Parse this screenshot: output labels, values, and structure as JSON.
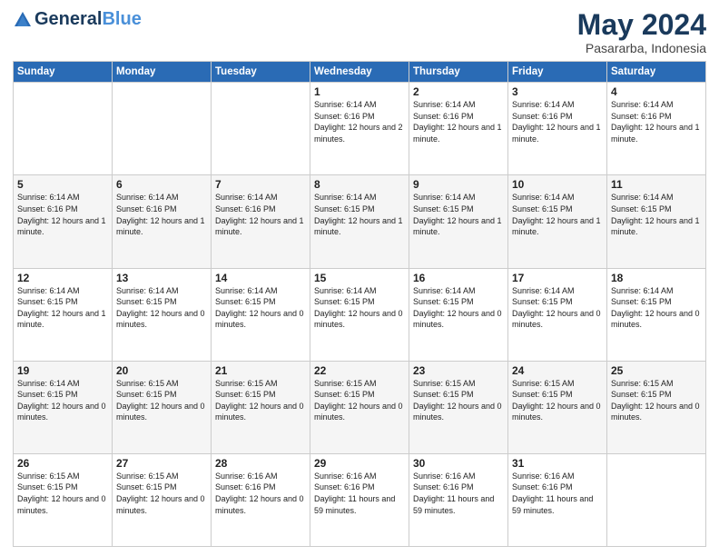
{
  "header": {
    "logo_line1": "General",
    "logo_line2": "Blue",
    "month_year": "May 2024",
    "location": "Pasararba, Indonesia"
  },
  "weekdays": [
    "Sunday",
    "Monday",
    "Tuesday",
    "Wednesday",
    "Thursday",
    "Friday",
    "Saturday"
  ],
  "weeks": [
    [
      {
        "day": "",
        "sunrise": "",
        "sunset": "",
        "daylight": "",
        "empty": true
      },
      {
        "day": "",
        "sunrise": "",
        "sunset": "",
        "daylight": "",
        "empty": true
      },
      {
        "day": "",
        "sunrise": "",
        "sunset": "",
        "daylight": "",
        "empty": true
      },
      {
        "day": "1",
        "sunrise": "Sunrise: 6:14 AM",
        "sunset": "Sunset: 6:16 PM",
        "daylight": "Daylight: 12 hours and 2 minutes."
      },
      {
        "day": "2",
        "sunrise": "Sunrise: 6:14 AM",
        "sunset": "Sunset: 6:16 PM",
        "daylight": "Daylight: 12 hours and 1 minute."
      },
      {
        "day": "3",
        "sunrise": "Sunrise: 6:14 AM",
        "sunset": "Sunset: 6:16 PM",
        "daylight": "Daylight: 12 hours and 1 minute."
      },
      {
        "day": "4",
        "sunrise": "Sunrise: 6:14 AM",
        "sunset": "Sunset: 6:16 PM",
        "daylight": "Daylight: 12 hours and 1 minute."
      }
    ],
    [
      {
        "day": "5",
        "sunrise": "Sunrise: 6:14 AM",
        "sunset": "Sunset: 6:16 PM",
        "daylight": "Daylight: 12 hours and 1 minute."
      },
      {
        "day": "6",
        "sunrise": "Sunrise: 6:14 AM",
        "sunset": "Sunset: 6:16 PM",
        "daylight": "Daylight: 12 hours and 1 minute."
      },
      {
        "day": "7",
        "sunrise": "Sunrise: 6:14 AM",
        "sunset": "Sunset: 6:16 PM",
        "daylight": "Daylight: 12 hours and 1 minute."
      },
      {
        "day": "8",
        "sunrise": "Sunrise: 6:14 AM",
        "sunset": "Sunset: 6:15 PM",
        "daylight": "Daylight: 12 hours and 1 minute."
      },
      {
        "day": "9",
        "sunrise": "Sunrise: 6:14 AM",
        "sunset": "Sunset: 6:15 PM",
        "daylight": "Daylight: 12 hours and 1 minute."
      },
      {
        "day": "10",
        "sunrise": "Sunrise: 6:14 AM",
        "sunset": "Sunset: 6:15 PM",
        "daylight": "Daylight: 12 hours and 1 minute."
      },
      {
        "day": "11",
        "sunrise": "Sunrise: 6:14 AM",
        "sunset": "Sunset: 6:15 PM",
        "daylight": "Daylight: 12 hours and 1 minute."
      }
    ],
    [
      {
        "day": "12",
        "sunrise": "Sunrise: 6:14 AM",
        "sunset": "Sunset: 6:15 PM",
        "daylight": "Daylight: 12 hours and 1 minute."
      },
      {
        "day": "13",
        "sunrise": "Sunrise: 6:14 AM",
        "sunset": "Sunset: 6:15 PM",
        "daylight": "Daylight: 12 hours and 0 minutes."
      },
      {
        "day": "14",
        "sunrise": "Sunrise: 6:14 AM",
        "sunset": "Sunset: 6:15 PM",
        "daylight": "Daylight: 12 hours and 0 minutes."
      },
      {
        "day": "15",
        "sunrise": "Sunrise: 6:14 AM",
        "sunset": "Sunset: 6:15 PM",
        "daylight": "Daylight: 12 hours and 0 minutes."
      },
      {
        "day": "16",
        "sunrise": "Sunrise: 6:14 AM",
        "sunset": "Sunset: 6:15 PM",
        "daylight": "Daylight: 12 hours and 0 minutes."
      },
      {
        "day": "17",
        "sunrise": "Sunrise: 6:14 AM",
        "sunset": "Sunset: 6:15 PM",
        "daylight": "Daylight: 12 hours and 0 minutes."
      },
      {
        "day": "18",
        "sunrise": "Sunrise: 6:14 AM",
        "sunset": "Sunset: 6:15 PM",
        "daylight": "Daylight: 12 hours and 0 minutes."
      }
    ],
    [
      {
        "day": "19",
        "sunrise": "Sunrise: 6:14 AM",
        "sunset": "Sunset: 6:15 PM",
        "daylight": "Daylight: 12 hours and 0 minutes."
      },
      {
        "day": "20",
        "sunrise": "Sunrise: 6:15 AM",
        "sunset": "Sunset: 6:15 PM",
        "daylight": "Daylight: 12 hours and 0 minutes."
      },
      {
        "day": "21",
        "sunrise": "Sunrise: 6:15 AM",
        "sunset": "Sunset: 6:15 PM",
        "daylight": "Daylight: 12 hours and 0 minutes."
      },
      {
        "day": "22",
        "sunrise": "Sunrise: 6:15 AM",
        "sunset": "Sunset: 6:15 PM",
        "daylight": "Daylight: 12 hours and 0 minutes."
      },
      {
        "day": "23",
        "sunrise": "Sunrise: 6:15 AM",
        "sunset": "Sunset: 6:15 PM",
        "daylight": "Daylight: 12 hours and 0 minutes."
      },
      {
        "day": "24",
        "sunrise": "Sunrise: 6:15 AM",
        "sunset": "Sunset: 6:15 PM",
        "daylight": "Daylight: 12 hours and 0 minutes."
      },
      {
        "day": "25",
        "sunrise": "Sunrise: 6:15 AM",
        "sunset": "Sunset: 6:15 PM",
        "daylight": "Daylight: 12 hours and 0 minutes."
      }
    ],
    [
      {
        "day": "26",
        "sunrise": "Sunrise: 6:15 AM",
        "sunset": "Sunset: 6:15 PM",
        "daylight": "Daylight: 12 hours and 0 minutes."
      },
      {
        "day": "27",
        "sunrise": "Sunrise: 6:15 AM",
        "sunset": "Sunset: 6:15 PM",
        "daylight": "Daylight: 12 hours and 0 minutes."
      },
      {
        "day": "28",
        "sunrise": "Sunrise: 6:16 AM",
        "sunset": "Sunset: 6:16 PM",
        "daylight": "Daylight: 12 hours and 0 minutes."
      },
      {
        "day": "29",
        "sunrise": "Sunrise: 6:16 AM",
        "sunset": "Sunset: 6:16 PM",
        "daylight": "Daylight: 11 hours and 59 minutes."
      },
      {
        "day": "30",
        "sunrise": "Sunrise: 6:16 AM",
        "sunset": "Sunset: 6:16 PM",
        "daylight": "Daylight: 11 hours and 59 minutes."
      },
      {
        "day": "31",
        "sunrise": "Sunrise: 6:16 AM",
        "sunset": "Sunset: 6:16 PM",
        "daylight": "Daylight: 11 hours and 59 minutes."
      },
      {
        "day": "",
        "sunrise": "",
        "sunset": "",
        "daylight": "",
        "empty": true
      }
    ]
  ]
}
